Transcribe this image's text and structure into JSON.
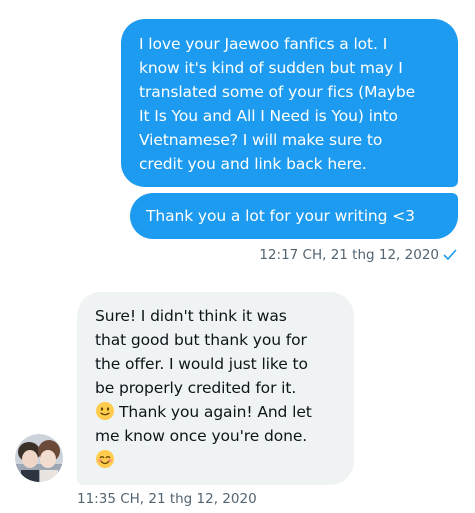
{
  "conversation": {
    "sent_message_1": {
      "lines": [
        "I love your Jaewoo fanfics a lot. I",
        "know it's kind of sudden but may I",
        "translated some of your fics (Maybe",
        "It Is You and All I Need is You) into",
        "Vietnamese? I will make sure to",
        "credit you and link back here."
      ]
    },
    "sent_message_2": {
      "text": "Thank you a lot for your writing <3"
    },
    "sent_timestamp": "12:17 CH, 21 thg 12, 2020",
    "received_message": {
      "lines": [
        "Sure! I didn't think it was",
        "that good but thank you for",
        "the offer. I would just like to",
        "be properly credited for it.",
        "Thank you again! And let",
        "me know once you're done."
      ]
    },
    "received_timestamp": "11:35 CH, 21 thg 12, 2020"
  },
  "colors": {
    "sent_bubble": "#1d9bf0",
    "received_bubble": "#eff3f4",
    "timestamp_text": "#536471"
  },
  "icons": {
    "read_receipt": "check-icon",
    "slight_smile": "slightly-smiling-face-icon",
    "blush": "smiling-face-with-smiling-eyes-icon",
    "avatar": "avatar"
  }
}
